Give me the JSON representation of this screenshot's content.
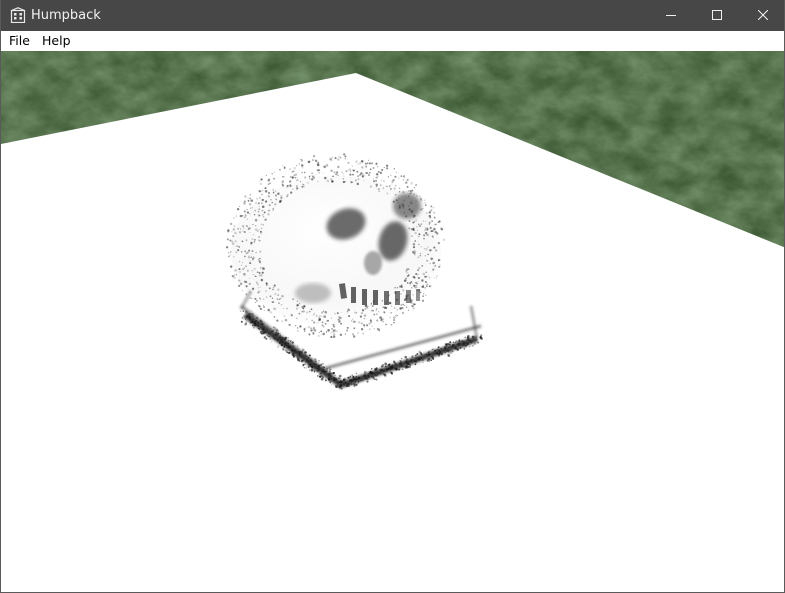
{
  "window": {
    "title": "Humpback",
    "icons": {
      "app": "building-icon",
      "minimize": "minimize-icon",
      "maximize": "maximize-icon",
      "close": "close-icon"
    }
  },
  "menubar": {
    "items": [
      "File",
      "Help"
    ]
  },
  "viewport": {
    "content": "3D render of a point-sampled human skull resting on a square base, placed on a white plane over a green textured ground",
    "colors": {
      "ground": "#3e5a35",
      "plane": "#ffffff",
      "points": "#1a1a1a"
    }
  }
}
